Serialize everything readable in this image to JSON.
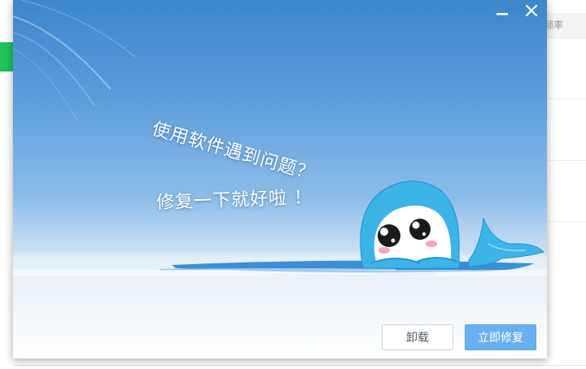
{
  "background_app": {
    "header_label": "频率"
  },
  "dialog": {
    "headline_line1": "使用软件遇到问题？",
    "headline_line2": "修复一下就好啦 ！",
    "uninstall_label": "卸载",
    "repair_label": "立即修复",
    "colors": {
      "repair_button": "#6aaff0",
      "sky_top": "#3d86cb",
      "mascot": "#3cb4e8"
    }
  },
  "icons": [
    "minimize-icon",
    "close-icon",
    "mascot-illustration"
  ]
}
